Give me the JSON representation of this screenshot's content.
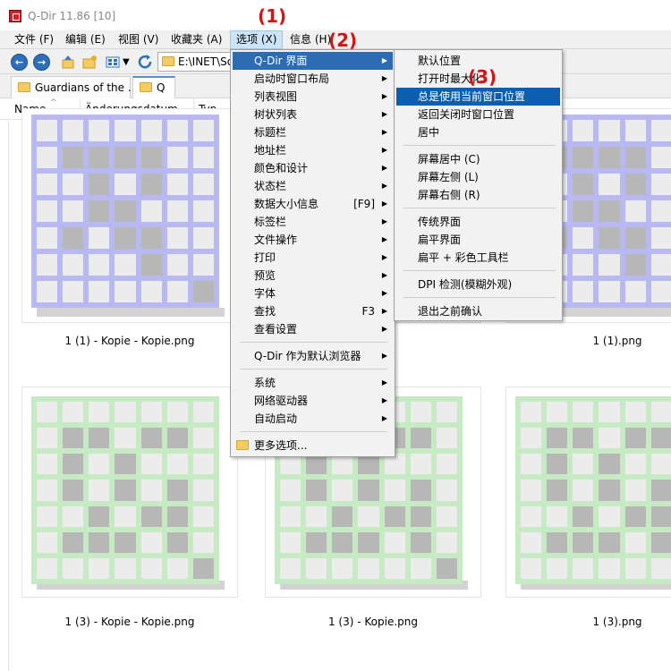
{
  "window": {
    "title": "Q-Dir 11.86 [10]"
  },
  "menubar": {
    "items": [
      {
        "label": "文件 (F)"
      },
      {
        "label": "编辑 (E)"
      },
      {
        "label": "视图 (V)"
      },
      {
        "label": "收藏夹 (A)"
      },
      {
        "label": "选项 (X)"
      },
      {
        "label": "信息 (H)"
      }
    ]
  },
  "toolbar": {
    "address": "E:\\INET\\So"
  },
  "tabs": [
    {
      "label": "Guardians of the ..."
    },
    {
      "label": "Q"
    }
  ],
  "columns": [
    {
      "label": "Name"
    },
    {
      "label": "Änderungsdatum"
    },
    {
      "label": "Typ"
    }
  ],
  "files": [
    {
      "name": "1 (1) - Kopie - Kopie.png",
      "color": "#b8b9f0"
    },
    {
      "name": "png",
      "color": "#b8b9f0"
    },
    {
      "name": "1 (1).png",
      "color": "#b8b9f0"
    },
    {
      "name": "1 (3) - Kopie - Kopie.png",
      "color": "#c6ebc4"
    },
    {
      "name": "1 (3) - Kopie.png",
      "color": "#c6ebc4"
    },
    {
      "name": "1 (3).png",
      "color": "#c6ebc4"
    }
  ],
  "options_menu": {
    "items": [
      {
        "label": "Q-Dir 界面",
        "has_submenu": true
      },
      {
        "label": "启动时窗口布局",
        "has_submenu": true
      },
      {
        "label": "列表视图",
        "has_submenu": true
      },
      {
        "label": "树状列表",
        "has_submenu": true
      },
      {
        "label": "标题栏",
        "has_submenu": true
      },
      {
        "label": "地址栏",
        "has_submenu": true
      },
      {
        "label": "颜色和设计",
        "has_submenu": true
      },
      {
        "label": "状态栏",
        "has_submenu": true
      },
      {
        "label": "数据大小信息",
        "shortcut": "[F9]",
        "has_submenu": true
      },
      {
        "label": "标签栏",
        "has_submenu": true
      },
      {
        "label": "文件操作",
        "has_submenu": true
      },
      {
        "label": "打印",
        "has_submenu": true
      },
      {
        "label": "预览",
        "has_submenu": true
      },
      {
        "label": "字体",
        "has_submenu": true
      },
      {
        "label": "查找",
        "shortcut": "F3",
        "has_submenu": true
      },
      {
        "label": "查看设置",
        "has_submenu": true
      },
      {
        "label": "Q-Dir 作为默认浏览器",
        "has_submenu": true
      },
      {
        "label": "系统",
        "has_submenu": true
      },
      {
        "label": "网络驱动器",
        "has_submenu": true
      },
      {
        "label": "自动启动",
        "has_submenu": true
      },
      {
        "label": "更多选项..."
      }
    ]
  },
  "submenu": {
    "items": [
      {
        "label": "默认位置"
      },
      {
        "label": "打开时最大化"
      },
      {
        "label": "总是使用当前窗口位置"
      },
      {
        "label": "返回关闭时窗口位置"
      },
      {
        "label": "居中"
      },
      {
        "label": "屏幕居中 (C)"
      },
      {
        "label": "屏幕左侧 (L)"
      },
      {
        "label": "屏幕右侧 (R)"
      },
      {
        "label": "传统界面"
      },
      {
        "label": "扁平界面"
      },
      {
        "label": "扁平 + 彩色工具栏"
      },
      {
        "label": "DPI 检测(模糊外观)"
      },
      {
        "label": "退出之前确认"
      }
    ]
  },
  "annotations": [
    {
      "label": "(1)"
    },
    {
      "label": "(2)"
    },
    {
      "label": "(3)"
    }
  ],
  "colors": {
    "menu_highlight": "#2d6cb3",
    "annotation": "#d21414"
  }
}
